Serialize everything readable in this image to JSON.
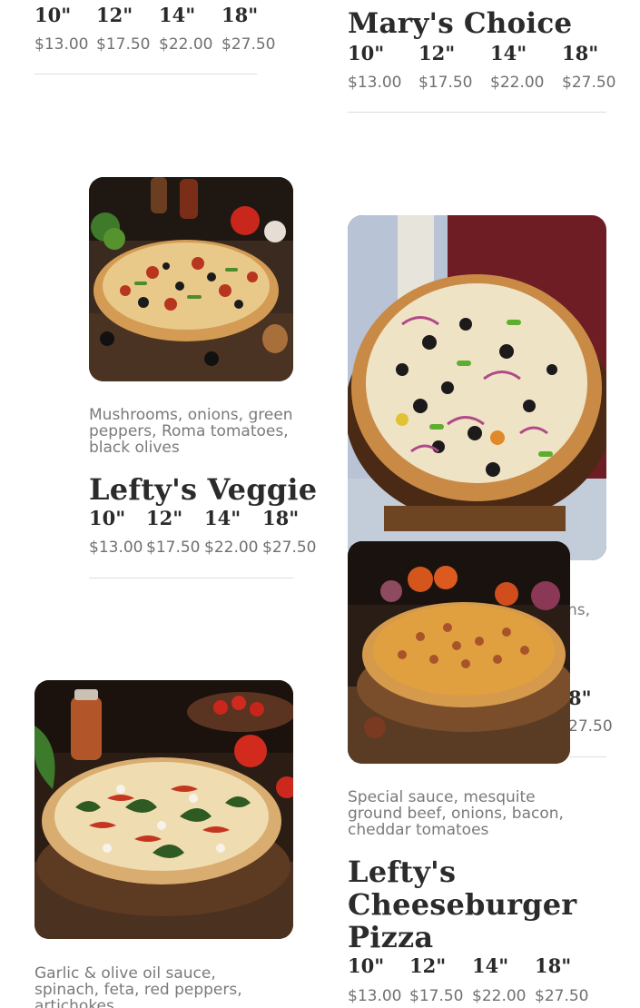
{
  "items": [
    {
      "id": "top-left",
      "title": "",
      "description": "",
      "sizes": [
        "10\"",
        "12\"",
        "14\"",
        "18\""
      ],
      "prices": [
        "$13.00",
        "$17.50",
        "$22.00",
        "$27.50"
      ]
    },
    {
      "id": "marys-choice",
      "title": "Mary's Choice",
      "description": "",
      "sizes": [
        "10\"",
        "12\"",
        "14\"",
        "18\""
      ],
      "prices": [
        "$13.00",
        "$17.50",
        "$22.00",
        "$27.50"
      ]
    },
    {
      "id": "leftys-veggie",
      "title": "Lefty's Veggie",
      "description": "Mushrooms, onions, green peppers, Roma tomatoes, black olives",
      "sizes": [
        "10\"",
        "12\"",
        "14\"",
        "18\""
      ],
      "prices": [
        "$13.00",
        "$17.50",
        "$22.00",
        "$27.50"
      ]
    },
    {
      "id": "hidden-middle",
      "description_fragment": "ns,",
      "size_fragment": "8\"",
      "price_fragment": "27.50"
    },
    {
      "id": "leftys-cheeseburger",
      "title_lines": [
        "Lefty's",
        "Cheeseburger",
        "Pizza"
      ],
      "description": "Special sauce, mesquite ground beef, onions, bacon, cheddar tomatoes",
      "sizes": [
        "10\"",
        "12\"",
        "14\"",
        "18\""
      ],
      "prices": [
        "$13.00",
        "$17.50",
        "$22.00",
        "$27.50"
      ]
    },
    {
      "id": "garlic-olive",
      "description": "Garlic & olive oil sauce, spinach, feta, red peppers, artichokes"
    }
  ],
  "colors": {
    "title": "#2b2b2b",
    "price": "#707070",
    "description": "#7a7a7a",
    "divider": "#dcdcdc"
  }
}
